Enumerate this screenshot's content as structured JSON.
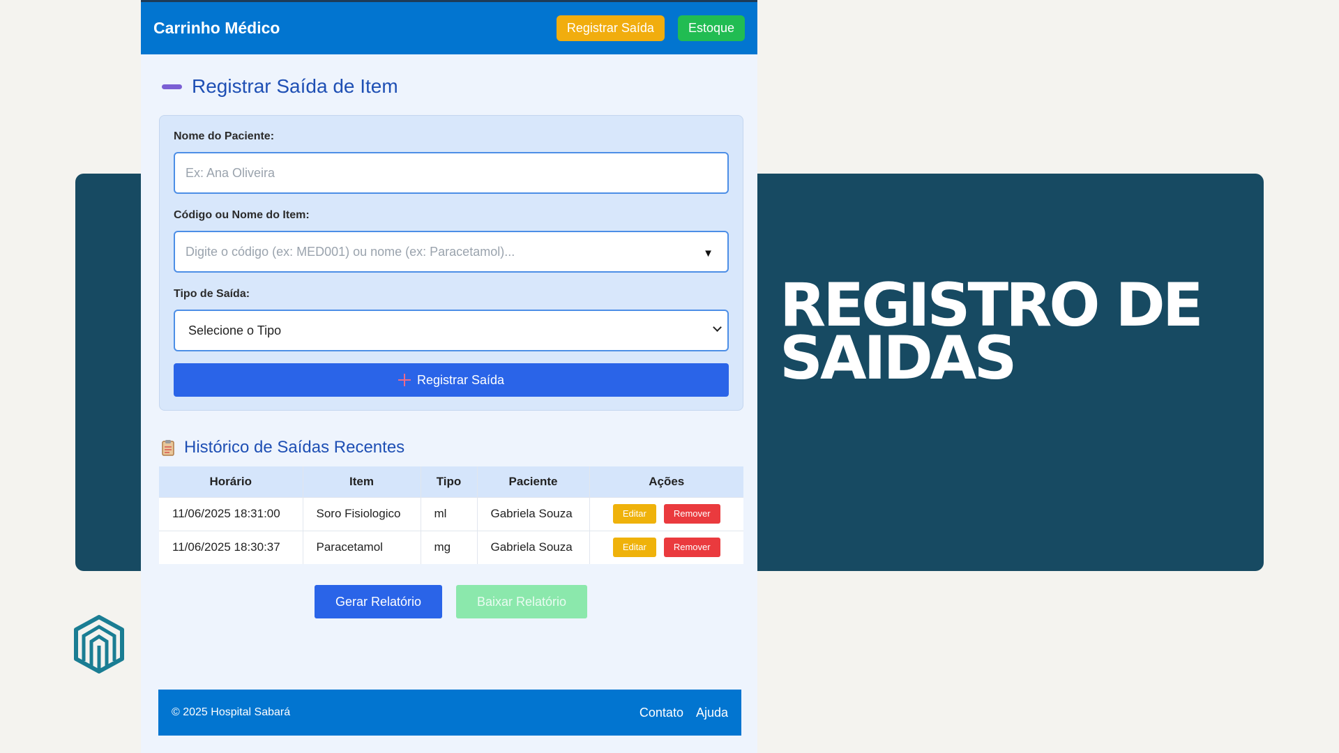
{
  "slide": {
    "title_line1": "REGISTRO DE",
    "title_line2": "SAIDAS",
    "panel_color": "#174a62"
  },
  "header": {
    "title": "Carrinho Médico",
    "register_exit_label": "Registrar Saída",
    "stock_label": "Estoque"
  },
  "form": {
    "section_title": "Registrar Saída de Item",
    "patient_label": "Nome do Paciente:",
    "patient_placeholder": "Ex: Ana Oliveira",
    "item_label": "Código ou Nome do Item:",
    "item_placeholder": "Digite o código (ex: MED001) ou nome (ex: Paracetamol)...",
    "type_label": "Tipo de Saída:",
    "type_selected": "Selecione o Tipo",
    "submit_label": "Registrar Saída"
  },
  "history": {
    "title": "Histórico de Saídas Recentes",
    "columns": [
      "Horário",
      "Item",
      "Tipo",
      "Paciente",
      "Ações"
    ],
    "rows": [
      {
        "time": "11/06/2025 18:31:00",
        "item": "Soro Fisiologico",
        "type": "ml",
        "patient": "Gabriela Souza"
      },
      {
        "time": "11/06/2025 18:30:37",
        "item": "Paracetamol",
        "type": "mg",
        "patient": "Gabriela Souza"
      }
    ],
    "edit_label": "Editar",
    "remove_label": "Remover"
  },
  "actions": {
    "generate_report": "Gerar Relatório",
    "download_report": "Baixar Relatório"
  },
  "footer": {
    "copyright": "© 2025 Hospital Sabará",
    "contact": "Contato",
    "help": "Ajuda"
  },
  "colors": {
    "primary_blue": "#0275d0",
    "button_blue": "#2a64e8",
    "warning": "#f1ad0e",
    "success": "#21bc52",
    "danger": "#ea3a3e"
  }
}
